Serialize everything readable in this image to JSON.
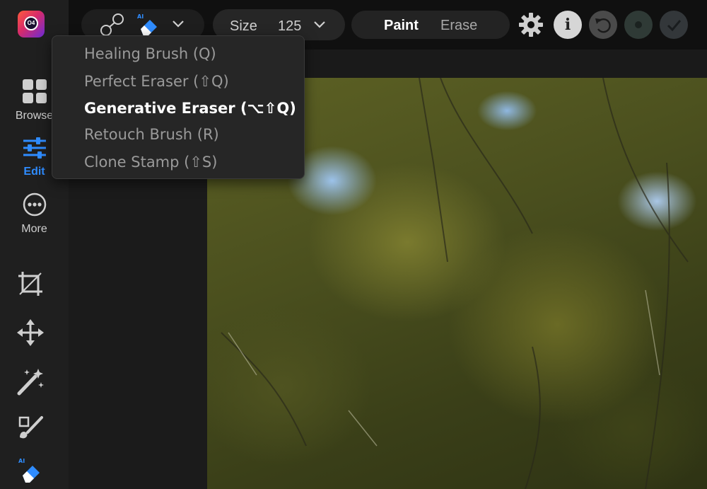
{
  "sidebar": {
    "logo_text": "O4",
    "items": [
      {
        "label": "Browse",
        "icon": "grid-icon",
        "active": false
      },
      {
        "label": "Edit",
        "icon": "sliders-icon",
        "active": true
      },
      {
        "label": "More",
        "icon": "more-icon",
        "active": false
      }
    ],
    "tools": [
      "crop-icon",
      "move-icon",
      "magic-wand-icon",
      "brush-icon",
      "ai-eraser-icon"
    ]
  },
  "toolbar": {
    "tool_picker": {
      "icons": [
        "healing-brush-icon",
        "ai-eraser-icon",
        "chevron-down-icon"
      ],
      "ai_badge": "AI"
    },
    "size": {
      "label": "Size",
      "value": "125"
    },
    "mode": {
      "paint_label": "Paint",
      "erase_label": "Erase",
      "selected": "Paint"
    },
    "buttons": [
      "gear-icon",
      "info-icon",
      "undo-icon",
      "redo-icon",
      "check-icon"
    ],
    "info_label": "i"
  },
  "tool_menu": {
    "items": [
      {
        "label": "Healing Brush (Q)",
        "selected": false
      },
      {
        "label": "Perfect Eraser (⇧Q)",
        "selected": false
      },
      {
        "label": "Generative Eraser (⌥⇧Q)",
        "selected": true
      },
      {
        "label": "Retouch Brush (R)",
        "selected": false
      },
      {
        "label": "Clone Stamp (⇧S)",
        "selected": false
      }
    ]
  },
  "colors": {
    "accent": "#2f8cff",
    "sidebar_bg": "#1f1f1f",
    "menu_bg": "#262626"
  }
}
